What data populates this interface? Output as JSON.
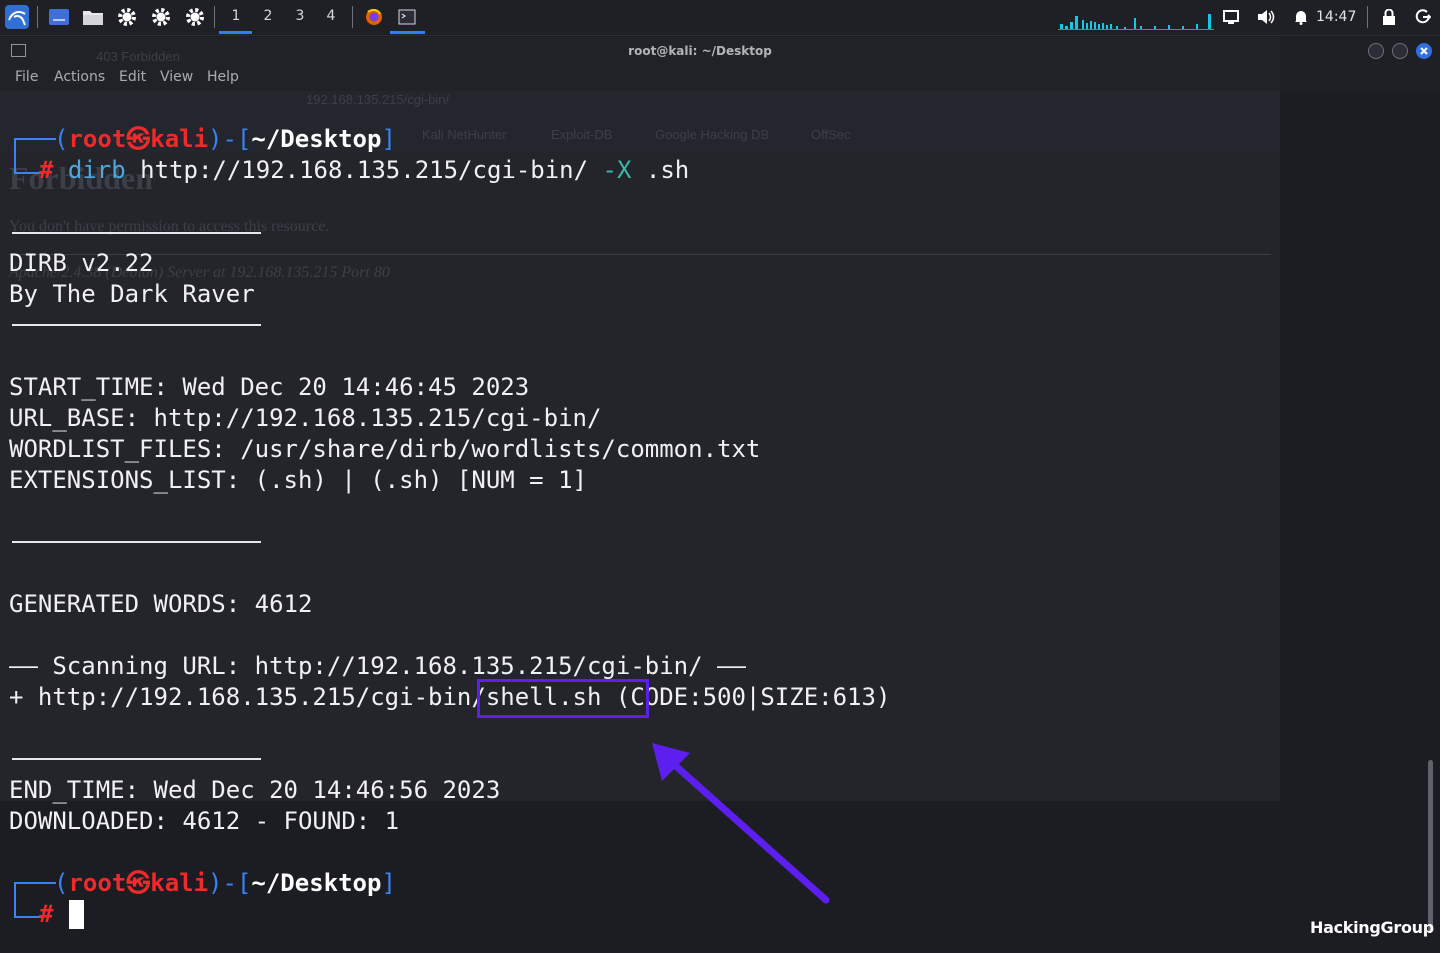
{
  "panel": {
    "workspaces": [
      "1",
      "2",
      "3",
      "4"
    ],
    "clock": "14:47",
    "tiny_folder_label": "..."
  },
  "window": {
    "title": "root@kali: ~/Desktop",
    "menu": [
      "File",
      "Actions",
      "Edit",
      "View",
      "Help"
    ]
  },
  "ghost_browser": {
    "tab": "403 Forbidden",
    "url": "192.168.135.215/cgi-bin/",
    "bookmarks": [
      "Kali NetHunter",
      "Exploit-DB",
      "Google Hacking DB",
      "OffSec"
    ],
    "heading": "Forbidden",
    "message": "You don't have permission to access this resource.",
    "footer": "Apache/2.4.38 (Debian) Server at 192.168.135.215 Port 80"
  },
  "terminal": {
    "prompt": {
      "open": "(",
      "user": "root",
      "at": "㉿",
      "host": "kali",
      "mid": ")-[",
      "path": "~/Desktop",
      "close": "]",
      "hash": "#"
    },
    "command": {
      "prog": "dirb",
      "url": "http://192.168.135.215/cgi-bin/",
      "flag": "-X",
      "ext": ".sh"
    },
    "banner_version": "DIRB v2.22",
    "banner_author": "By The Dark Raver",
    "start_time": "START_TIME: Wed Dec 20 14:46:45 2023",
    "url_base": "URL_BASE: http://192.168.135.215/cgi-bin/",
    "wordlist": "WORDLIST_FILES: /usr/share/dirb/wordlists/common.txt",
    "extensions": "EXTENSIONS_LIST: (.sh) | (.sh) [NUM = 1]",
    "generated": "GENERATED WORDS: 4612",
    "scanning": "—— Scanning URL: http://192.168.135.215/cgi-bin/ ——",
    "result": "+ http://192.168.135.215/cgi-bin/shell.sh (CODE:500|SIZE:613)",
    "end_time": "END_TIME: Wed Dec 20 14:46:56 2023",
    "downloaded": "DOWNLOADED: 4612 - FOUND: 1"
  },
  "watermark": "HackingGroup",
  "colors": {
    "accent": "#367bf0",
    "prompt_blue": "#3b82f6",
    "prompt_red": "#ee2a2a",
    "highlight": "#5d1ef0"
  }
}
